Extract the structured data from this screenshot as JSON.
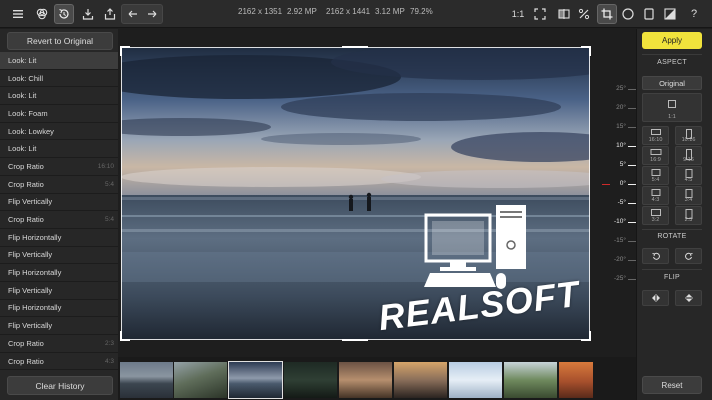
{
  "toolbar": {
    "info_original_dims": "2162 x 1351",
    "info_original_mp": "2.92 MP",
    "info_crop_dims": "2162 x 1441",
    "info_crop_mp": "3.12 MP",
    "zoom": "79.2%",
    "zoom_1to1": "1:1"
  },
  "left_panel": {
    "revert_label": "Revert to Original",
    "clear_history_label": "Clear History",
    "history": [
      {
        "label": "Look: Lit",
        "meta": ""
      },
      {
        "label": "Look: Chill",
        "meta": ""
      },
      {
        "label": "Look: Lit",
        "meta": ""
      },
      {
        "label": "Look: Foam",
        "meta": ""
      },
      {
        "label": "Look: Lowkey",
        "meta": ""
      },
      {
        "label": "Look: Lit",
        "meta": ""
      },
      {
        "label": "Crop Ratio",
        "meta": "16:10"
      },
      {
        "label": "Crop Ratio",
        "meta": "5:4"
      },
      {
        "label": "Flip Vertically",
        "meta": ""
      },
      {
        "label": "Crop Ratio",
        "meta": "5:4"
      },
      {
        "label": "Flip Horizontally",
        "meta": ""
      },
      {
        "label": "Flip Vertically",
        "meta": ""
      },
      {
        "label": "Flip Horizontally",
        "meta": ""
      },
      {
        "label": "Flip Vertically",
        "meta": ""
      },
      {
        "label": "Flip Horizontally",
        "meta": ""
      },
      {
        "label": "Flip Vertically",
        "meta": ""
      },
      {
        "label": "Crop Ratio",
        "meta": "2:3"
      },
      {
        "label": "Crop Ratio",
        "meta": "4:3"
      }
    ]
  },
  "ruler": {
    "ticks": [
      "25°",
      "20°",
      "15°",
      "10°",
      "5°",
      "0°",
      "-5°",
      "-10°",
      "-15°",
      "-20°",
      "-25°"
    ]
  },
  "watermark": {
    "text": "REALSOFT"
  },
  "right_panel": {
    "apply_label": "Apply",
    "aspect_title": "ASPECT",
    "aspect_original": "Original",
    "aspect_ratios": [
      "1:1",
      "16:10",
      "10:16",
      "16:9",
      "9:16",
      "5:4",
      "4:5",
      "4:3",
      "3:4",
      "3:2",
      "2:3"
    ],
    "rotate_title": "ROTATE",
    "flip_title": "FLIP",
    "reset_label": "Reset"
  },
  "colors": {
    "apply_yellow": "#f1e33c",
    "panel_bg": "#272727",
    "zero_marker": "#d02a2a"
  },
  "icons": [
    "menu-icon",
    "looks-icon",
    "history-icon",
    "import-icon",
    "share-icon",
    "undo-icon",
    "redo-icon",
    "fit-icon",
    "compare-icon",
    "percent-icon",
    "crop-icon",
    "circle-icon",
    "rect-icon",
    "mask-icon",
    "help-icon"
  ]
}
